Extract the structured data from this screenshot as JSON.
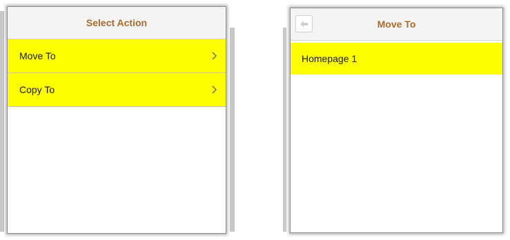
{
  "select_action": {
    "title": "Select Action",
    "items": [
      {
        "label": "Move To"
      },
      {
        "label": "Copy To"
      }
    ]
  },
  "move_to": {
    "title": "Move To",
    "back_icon": "back-arrow-icon",
    "items": [
      {
        "label": "Homepage 1"
      }
    ]
  },
  "colors": {
    "highlight": "#ffff00",
    "title": "#a86a2e",
    "header_bg": "#f4f4f4"
  }
}
